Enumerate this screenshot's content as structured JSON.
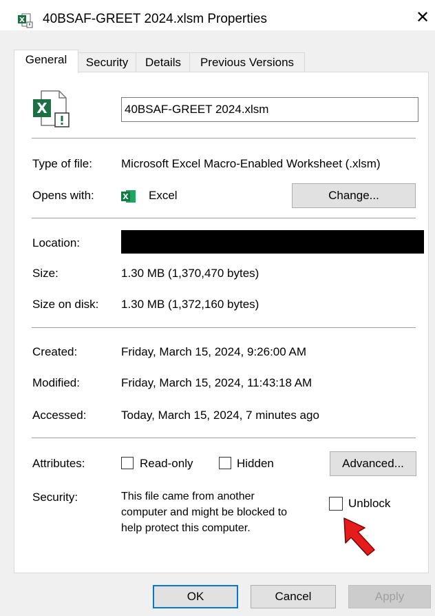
{
  "window": {
    "title": "40BSAF-GREET 2024.xlsm Properties",
    "close_glyph": "✕"
  },
  "tabs": [
    {
      "label": "General",
      "active": true
    },
    {
      "label": "Security"
    },
    {
      "label": "Details"
    },
    {
      "label": "Previous Versions"
    }
  ],
  "general": {
    "filename": "40BSAF-GREET 2024.xlsm",
    "type_label": "Type of file:",
    "type_value": "Microsoft Excel Macro-Enabled Worksheet (.xlsm)",
    "opens_label": "Opens with:",
    "opens_value": "Excel",
    "change_button": "Change...",
    "location_label": "Location:",
    "size_label": "Size:",
    "size_value": "1.30 MB (1,370,470 bytes)",
    "size_disk_label": "Size on disk:",
    "size_disk_value": "1.30 MB (1,372,160 bytes)",
    "created_label": "Created:",
    "created_value": "Friday, March 15, 2024, 9:26:00 AM",
    "modified_label": "Modified:",
    "modified_value": "Friday, March 15, 2024, 11:43:18 AM",
    "accessed_label": "Accessed:",
    "accessed_value": "Today, March 15, 2024, 7 minutes ago",
    "attributes_label": "Attributes:",
    "readonly_label": "Read-only",
    "hidden_label": "Hidden",
    "advanced_button": "Advanced...",
    "security_label": "Security:",
    "security_text_1": "This file came from another",
    "security_text_2": "computer and might be blocked to",
    "security_text_3": "help protect this computer.",
    "unblock_label": "Unblock"
  },
  "footer": {
    "ok": "OK",
    "cancel": "Cancel",
    "apply": "Apply"
  },
  "colors": {
    "excel_green": "#1d7044",
    "accent_blue": "#0078d7",
    "arrow_red": "#e51c1c"
  }
}
